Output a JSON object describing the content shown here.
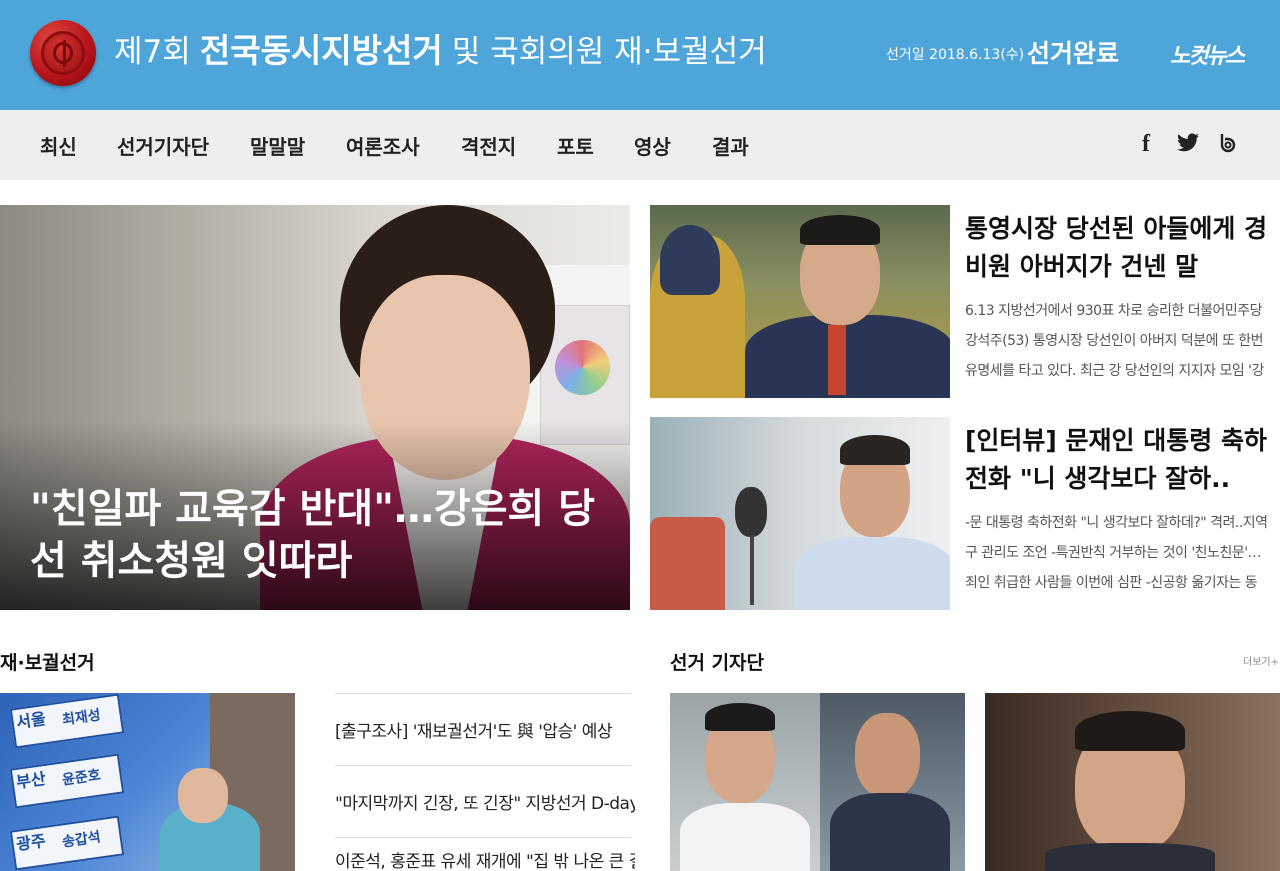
{
  "header": {
    "title_pre": "제7회",
    "title_main": "전국동시지방선거",
    "title_post": "및 국회의원 재·보궐선거",
    "election_date": "선거일 2018.6.13(수)",
    "election_status": "선거완료",
    "brand": "노컷뉴스",
    "colors": {
      "header_bg": "#4ea5d9",
      "nav_bg": "#eeeeee"
    }
  },
  "nav": {
    "items": [
      "최신",
      "선거기자단",
      "말말말",
      "여론조사",
      "격전지",
      "포토",
      "영상",
      "결과"
    ],
    "social": [
      "facebook-icon",
      "twitter-icon",
      "blog-icon"
    ]
  },
  "hero": {
    "title": "\"친일파 교육감 반대\"…강은희 당선 취소청원 잇따라"
  },
  "articles": [
    {
      "title": "통영시장 당선된 아들에게 경비원 아버지가 건넨 말",
      "summary": "6.13 지방선거에서 930표 차로 승리한 더불어민주당 강석주(53) 통영시장 당선인이 아버지 덕분에 또 한번 유명세를 타고 있다.  최근 강 당선인의 지지자 모임 '강"
    },
    {
      "title": "[인터뷰] 문재인 대통령 축하 전화 \"니 생각보다 잘하..",
      "summary": "-문 대통령 축하전화 \"니 생각보다 잘하데?\" 격려..지역구 관리도 조언 -특권반칙 거부하는 것이 '친노친문'… 죄인 취급한 사람들 이번에 심판  -신공항 옮기자는 동"
    }
  ],
  "sections": {
    "by_election": {
      "title": "재·보궐선거",
      "items": [
        "[출구조사] '재보궐선거'도 與 '압승' 예상",
        "\"마지막까지 긴장, 또 긴장\" 지방선거 D-day",
        "이준석, 홍준표 유세 재개에 \"집 밖 나온 큰 결"
      ]
    },
    "reporters": {
      "title": "선거 기자단",
      "more": "더보기+"
    }
  },
  "photo_boards": {
    "labels": [
      "서울",
      "부산",
      "광주"
    ],
    "names": [
      "최재성",
      "윤준호",
      "송갑석"
    ]
  }
}
